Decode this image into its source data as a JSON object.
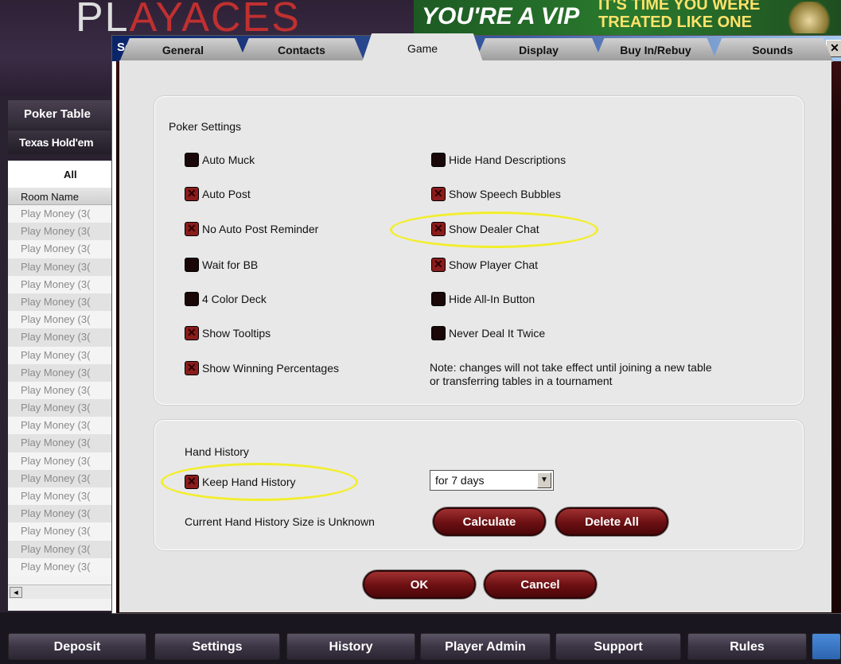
{
  "app": {
    "logo_text_1": "PL",
    "logo_text_2": "AY",
    "logo_text_3": "ACES",
    "banner_main": "YOU'RE A VIP",
    "banner_sub_1": "IT'S TIME YOU WERE",
    "banner_sub_2": "TREATED LIKE ONE"
  },
  "lobby": {
    "header": "Poker Table",
    "game": "Texas Hold'em",
    "filter": "All",
    "column_header": "Room Name",
    "rows": [
      "Play Money (3(",
      "Play Money (3(",
      "Play Money (3(",
      "Play Money (3(",
      "Play Money (3(",
      "Play Money (3(",
      "Play Money (3(",
      "Play Money (3(",
      "Play Money (3(",
      "Play Money (3(",
      "Play Money (3(",
      "Play Money (3(",
      "Play Money (3(",
      "Play Money (3(",
      "Play Money (3(",
      "Play Money (3(",
      "Play Money (3(",
      "Play Money (3(",
      "Play Money (3(",
      "Play Money (3(",
      "Play Money (3("
    ],
    "scroll_left": "◄"
  },
  "bottom_nav": [
    "Deposit",
    "Settings",
    "History",
    "Player Admin",
    "Support",
    "Rules"
  ],
  "dialog": {
    "title": "Settings",
    "close": "✕",
    "tabs": [
      "General",
      "Contacts",
      "Game",
      "Display",
      "Buy In/Rebuy",
      "Sounds"
    ],
    "active_tab": "Game",
    "poker_settings": {
      "title": "Poker Settings",
      "left": [
        {
          "label": "Auto Muck",
          "checked": false
        },
        {
          "label": "Auto Post",
          "checked": true
        },
        {
          "label": "No Auto Post Reminder",
          "checked": true
        },
        {
          "label": "Wait for BB",
          "checked": false
        },
        {
          "label": "4 Color Deck",
          "checked": false
        },
        {
          "label": "Show Tooltips",
          "checked": true
        },
        {
          "label": "Show Winning Percentages",
          "checked": true
        }
      ],
      "right": [
        {
          "label": "Hide Hand Descriptions",
          "checked": false
        },
        {
          "label": "Show Speech Bubbles",
          "checked": true
        },
        {
          "label": "Show Dealer Chat",
          "checked": true
        },
        {
          "label": "Show Player Chat",
          "checked": true
        },
        {
          "label": "Hide All-In Button",
          "checked": false
        },
        {
          "label": "Never Deal It Twice",
          "checked": false
        }
      ],
      "note_1": "Note: changes will not take effect until joining a new table",
      "note_2": "or transferring tables in a tournament"
    },
    "hand_history": {
      "title": "Hand History",
      "keep_label": "Keep Hand History",
      "keep_checked": true,
      "duration": "for 7 days",
      "size_text": "Current Hand History Size is Unknown",
      "calculate": "Calculate",
      "delete_all": "Delete All"
    },
    "ok": "OK",
    "cancel": "Cancel"
  },
  "colors": {
    "highlight": "#f2ee2a",
    "checkbox_on": "#8a1c1c",
    "button": "#6b0f12"
  }
}
